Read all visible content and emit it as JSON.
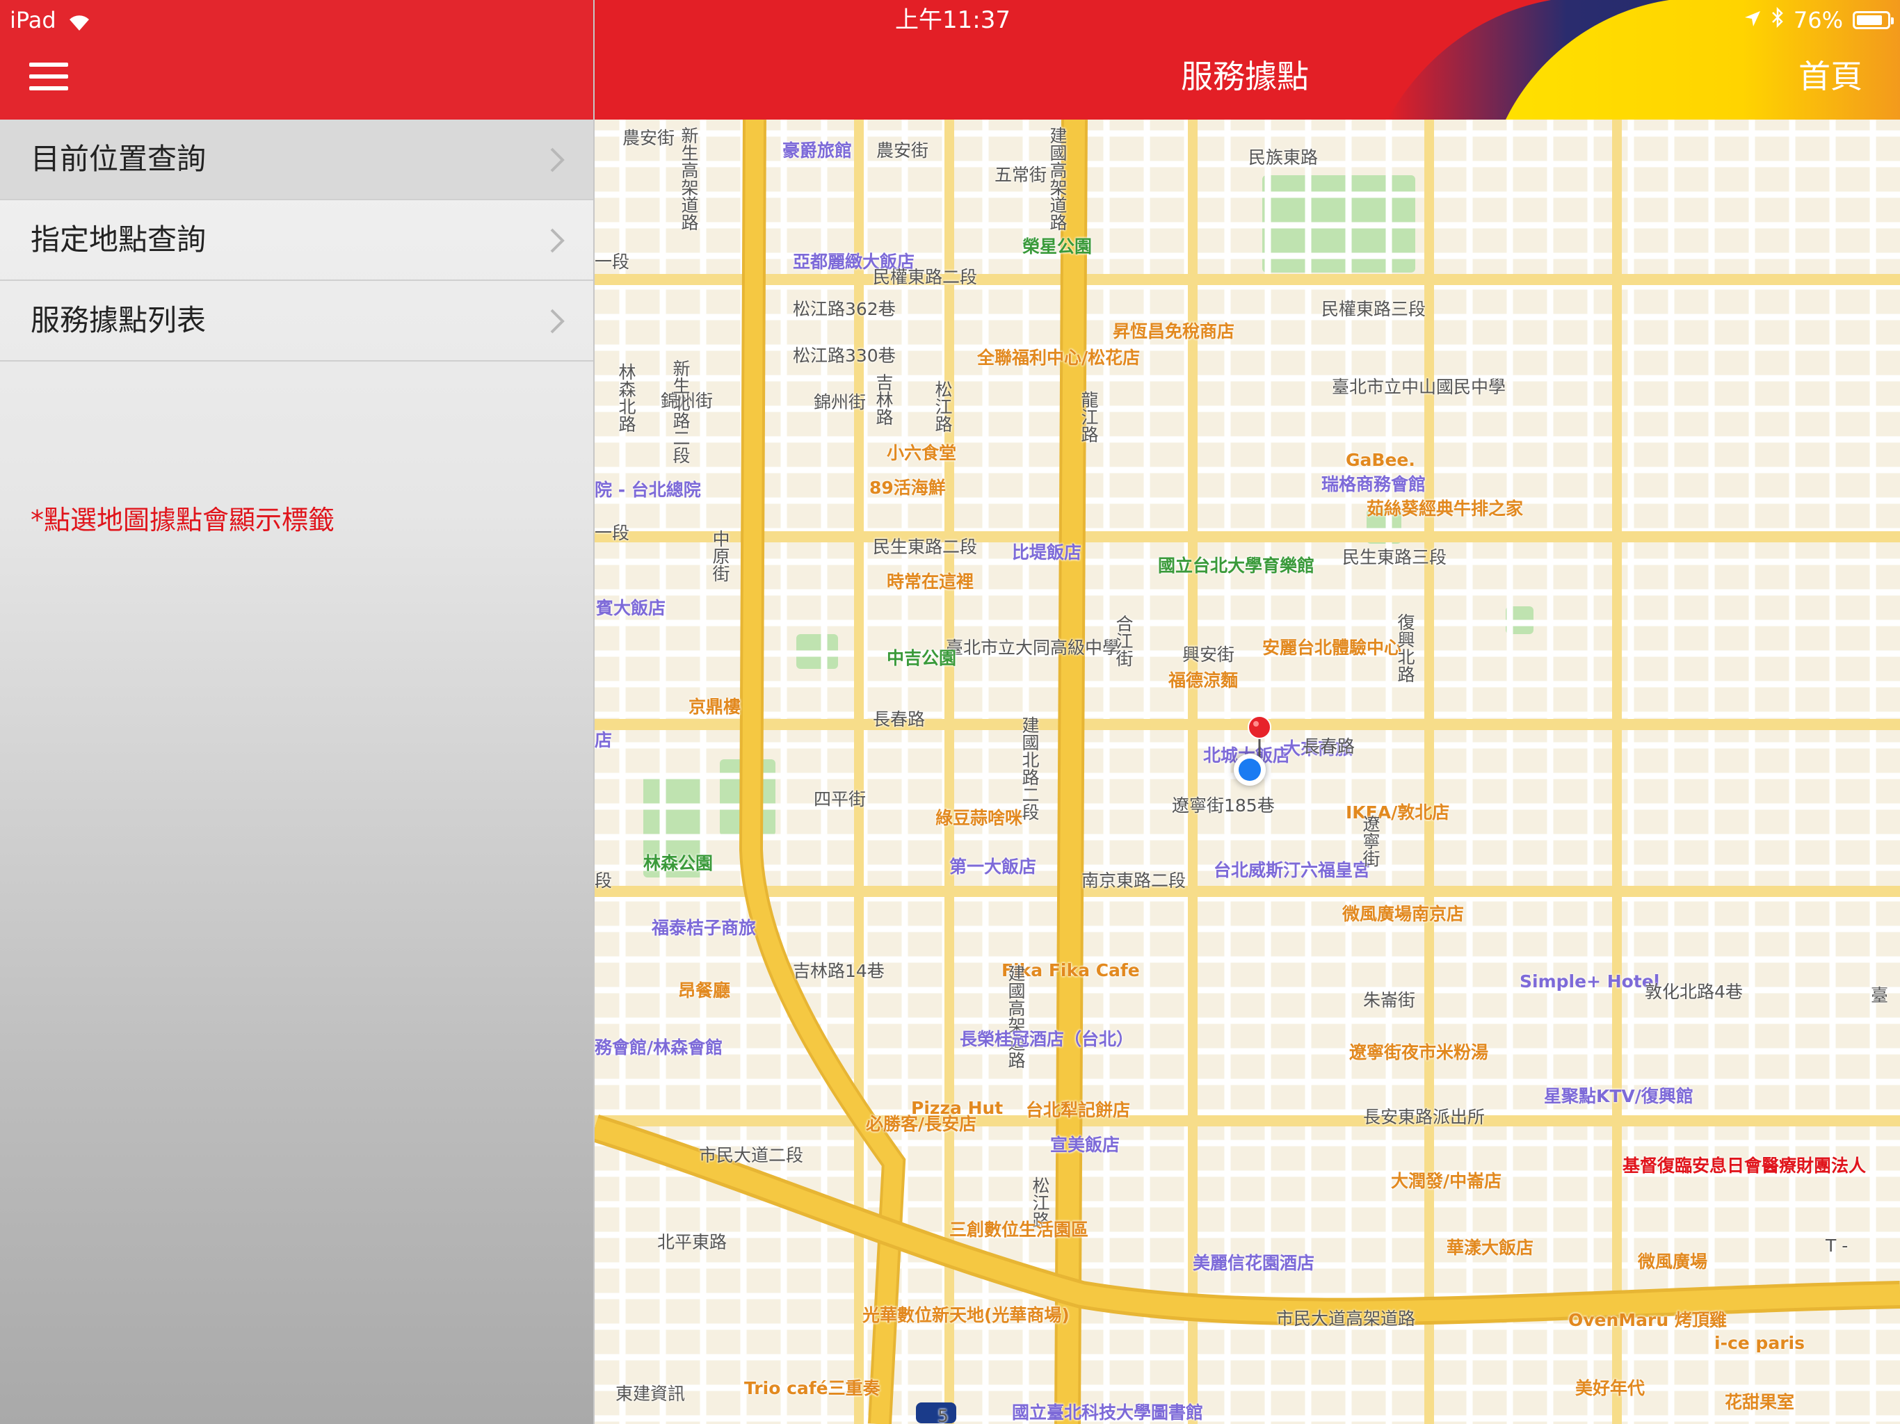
{
  "status_bar": {
    "device": "iPad",
    "time": "上午11:37",
    "battery": "76%"
  },
  "nav": {
    "title": "服務據點",
    "home": "首頁"
  },
  "sidebar": {
    "items": [
      {
        "label": "目前位置查詢"
      },
      {
        "label": "指定地點查詢"
      },
      {
        "label": "服務據點列表"
      }
    ],
    "hint": "*點選地圖據點會顯示標籤"
  },
  "colors": {
    "brand_red": "#e31f26",
    "road_major": "#f5c842",
    "road_minor": "#ffffff",
    "map_bg": "#f6f0e1",
    "park": "#bfe3b0",
    "label_food": "#e2891f",
    "label_hotel": "#7d6ad8",
    "label_park": "#3a9a3a",
    "label_road": "#555555"
  },
  "map": {
    "labels": [
      {
        "t": "農安街",
        "c": "road"
      },
      {
        "t": "豪爵旅館",
        "c": "hotel"
      },
      {
        "t": "農安街",
        "c": "road"
      },
      {
        "t": "五常街",
        "c": "road"
      },
      {
        "t": "民族東路",
        "c": "road"
      },
      {
        "t": "新生高架道路",
        "c": "road"
      },
      {
        "t": "建國高架道路",
        "c": "road"
      },
      {
        "t": "一段",
        "c": "road"
      },
      {
        "t": "亞都麗緻大飯店",
        "c": "hotel"
      },
      {
        "t": "榮星公園",
        "c": "park"
      },
      {
        "t": "民權東路二段",
        "c": "road"
      },
      {
        "t": "民權東路三段",
        "c": "road"
      },
      {
        "t": "松江路362巷",
        "c": "road"
      },
      {
        "t": "昇恆昌免稅商店",
        "c": "food"
      },
      {
        "t": "松江路330巷",
        "c": "road"
      },
      {
        "t": "全聯福利中心/松花店",
        "c": "food"
      },
      {
        "t": "臺北市立中山國民中學",
        "c": "road"
      },
      {
        "t": "林森北路",
        "c": "road"
      },
      {
        "t": "錦州街",
        "c": "road"
      },
      {
        "t": "新生北路二段",
        "c": "road"
      },
      {
        "t": "吉林路",
        "c": "road"
      },
      {
        "t": "錦州街",
        "c": "road"
      },
      {
        "t": "松江路",
        "c": "road"
      },
      {
        "t": "龍江路",
        "c": "road"
      },
      {
        "t": "小六食堂",
        "c": "food"
      },
      {
        "t": "GaBee.",
        "c": "food"
      },
      {
        "t": "89活海鮮",
        "c": "food"
      },
      {
        "t": "瑞格商務會館",
        "c": "hotel"
      },
      {
        "t": "院 - 台北總院",
        "c": "hotel"
      },
      {
        "t": "茹絲葵經典牛排之家",
        "c": "food"
      },
      {
        "t": "一段",
        "c": "road"
      },
      {
        "t": "中原街",
        "c": "road"
      },
      {
        "t": "民生東路二段",
        "c": "road"
      },
      {
        "t": "比堤飯店",
        "c": "hotel"
      },
      {
        "t": "國立台北大學育樂館",
        "c": "park"
      },
      {
        "t": "民生東路三段",
        "c": "road"
      },
      {
        "t": "時常在這裡",
        "c": "food"
      },
      {
        "t": "賓大飯店",
        "c": "hotel"
      },
      {
        "t": "臺北市立大同高級中學",
        "c": "road"
      },
      {
        "t": "合江街",
        "c": "road"
      },
      {
        "t": "興安街",
        "c": "road"
      },
      {
        "t": "中吉公園",
        "c": "park"
      },
      {
        "t": "福德涼麵",
        "c": "food"
      },
      {
        "t": "安麗台北體驗中心",
        "c": "food"
      },
      {
        "t": "復興北路",
        "c": "road"
      },
      {
        "t": "京鼎樓",
        "c": "food"
      },
      {
        "t": "長春路",
        "c": "road"
      },
      {
        "t": "建國北路二段",
        "c": "road"
      },
      {
        "t": "北城大飯店",
        "c": "hotel"
      },
      {
        "t": "大來商旅",
        "c": "hotel"
      },
      {
        "t": "長春路",
        "c": "road"
      },
      {
        "t": "店",
        "c": "hotel"
      },
      {
        "t": "四平街",
        "c": "road"
      },
      {
        "t": "綠豆蒜啥咪",
        "c": "food"
      },
      {
        "t": "遼寧街185巷",
        "c": "road"
      },
      {
        "t": "IKEA/敦北店",
        "c": "food"
      },
      {
        "t": "林森公園",
        "c": "park"
      },
      {
        "t": "第一大飯店",
        "c": "hotel"
      },
      {
        "t": "南京東路二段",
        "c": "road"
      },
      {
        "t": "台北威斯汀六福皇宮",
        "c": "hotel"
      },
      {
        "t": "遼寧街",
        "c": "road"
      },
      {
        "t": "段",
        "c": "road"
      },
      {
        "t": "福泰桔子商旅",
        "c": "hotel"
      },
      {
        "t": "微風廣場南京店",
        "c": "food"
      },
      {
        "t": "吉林路14巷",
        "c": "road"
      },
      {
        "t": "Fika Fika Cafe",
        "c": "food"
      },
      {
        "t": "建國高架道路",
        "c": "road"
      },
      {
        "t": "昂餐廳",
        "c": "food"
      },
      {
        "t": "朱崙街",
        "c": "road"
      },
      {
        "t": "Simple+ Hotel",
        "c": "hotel"
      },
      {
        "t": "敦化北路4巷",
        "c": "road"
      },
      {
        "t": "務會館/林森會館",
        "c": "hotel"
      },
      {
        "t": "長榮桂冠酒店（台北）",
        "c": "hotel"
      },
      {
        "t": "遼寧街夜市米粉湯",
        "c": "food"
      },
      {
        "t": "星聚點KTV/復興館",
        "c": "hotel"
      },
      {
        "t": "Pizza Hut",
        "c": "food"
      },
      {
        "t": "必勝客/長安店",
        "c": "food"
      },
      {
        "t": "台北犁記餅店",
        "c": "food"
      },
      {
        "t": "長安東路派出所",
        "c": "road"
      },
      {
        "t": "宣美飯店",
        "c": "hotel"
      },
      {
        "t": "基督復臨安息日會醫療財團法人",
        "c": "food_red"
      },
      {
        "t": "市民大道二段",
        "c": "road"
      },
      {
        "t": "松江路",
        "c": "road"
      },
      {
        "t": "大潤發/中崙店",
        "c": "food"
      },
      {
        "t": "三創數位生活園區",
        "c": "food"
      },
      {
        "t": "北平東路",
        "c": "road"
      },
      {
        "t": "華漾大飯店",
        "c": "food"
      },
      {
        "t": "微風廣場",
        "c": "food"
      },
      {
        "t": "美麗信花園酒店",
        "c": "hotel"
      },
      {
        "t": "光華數位新天地(光華商場)",
        "c": "food"
      },
      {
        "t": "市民大道高架道路",
        "c": "road"
      },
      {
        "t": "OvenMaru 烤頂雞",
        "c": "food"
      },
      {
        "t": "i-ce paris",
        "c": "food"
      },
      {
        "t": "Trio café三重奏",
        "c": "food"
      },
      {
        "t": "美好年代",
        "c": "food"
      },
      {
        "t": "花甜果室",
        "c": "food"
      },
      {
        "t": "國立臺北科技大學圖書館",
        "c": "hotel"
      },
      {
        "t": "東建資訊",
        "c": "road"
      },
      {
        "t": "T -",
        "c": "road"
      },
      {
        "t": "臺",
        "c": "road"
      },
      {
        "t": "5",
        "c": "road"
      }
    ]
  }
}
